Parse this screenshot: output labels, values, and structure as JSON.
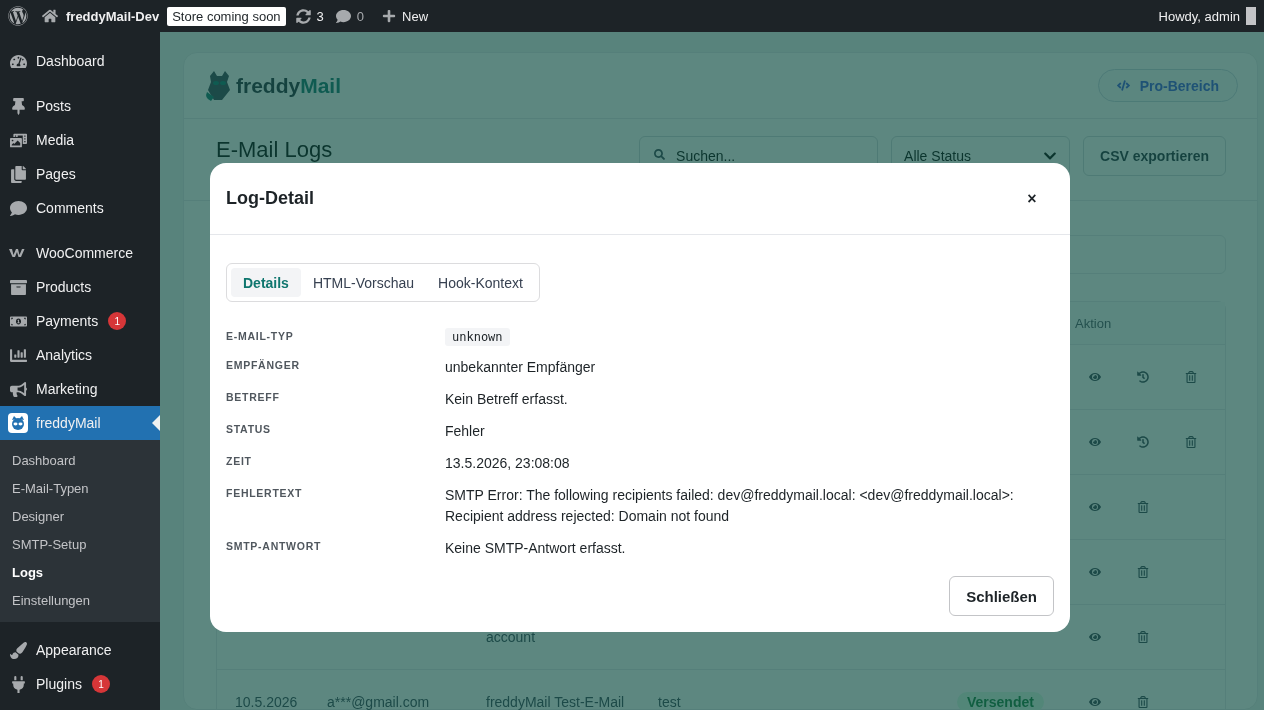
{
  "admin_bar": {
    "site": "freddyMail-Dev",
    "store_badge": "Store coming soon",
    "updates": "3",
    "comments": "0",
    "new": "New",
    "greeting": "Howdy, admin"
  },
  "sidebar": {
    "groups": [
      [
        {
          "label": "Dashboard",
          "selected": false
        }
      ],
      [
        {
          "label": "Posts",
          "selected": false
        },
        {
          "label": "Media",
          "selected": false
        },
        {
          "label": "Pages",
          "selected": false
        },
        {
          "label": "Comments",
          "selected": false
        }
      ],
      [
        {
          "label": "WooCommerce",
          "selected": false
        },
        {
          "label": "Products",
          "selected": false
        },
        {
          "label": "Payments",
          "selected": false,
          "badge": "1"
        },
        {
          "label": "Analytics",
          "selected": false
        },
        {
          "label": "Marketing",
          "selected": false
        },
        {
          "label": "freddyMail",
          "selected": true,
          "children": [
            {
              "label": "Dashboard",
              "selected": false
            },
            {
              "label": "E-Mail-Typen",
              "selected": false
            },
            {
              "label": "Designer",
              "selected": false
            },
            {
              "label": "SMTP-Setup",
              "selected": false
            },
            {
              "label": "Logs",
              "selected": true
            },
            {
              "label": "Einstellungen",
              "selected": false
            }
          ]
        }
      ],
      [
        {
          "label": "Appearance",
          "selected": false
        },
        {
          "label": "Plugins",
          "selected": false,
          "badge": "1"
        }
      ]
    ]
  },
  "header": {
    "logo": {
      "parts": [
        "freddy",
        "Mail"
      ]
    },
    "pro_button": "Pro-Bereich"
  },
  "toolbar": {
    "title": "E-Mail Logs",
    "search": {
      "placeholder": "Suchen..."
    },
    "status_filter": "Alle Status",
    "export_button": "CSV exportieren"
  },
  "table": {
    "columns": [
      "Aktion"
    ],
    "rows": [
      {
        "actions": [
          {
            "kind": "view"
          },
          {
            "kind": "resend"
          },
          {
            "kind": "delete"
          }
        ]
      },
      {
        "actions": [
          {
            "kind": "view"
          },
          {
            "kind": "resend"
          },
          {
            "kind": "delete"
          }
        ]
      },
      {
        "actions": [
          {
            "kind": "view"
          },
          {
            "kind": "delete"
          }
        ]
      },
      {
        "actions": [
          {
            "kind": "view"
          },
          {
            "kind": "delete"
          }
        ]
      },
      {
        "subject": "account",
        "actions": [
          {
            "kind": "view"
          },
          {
            "kind": "delete"
          }
        ]
      },
      {
        "date": "10.5.2026",
        "recipient": "a***@gmail.com",
        "subject": "freddyMail Test-E-Mail",
        "type": "test",
        "status": {
          "label": "Versendet",
          "kind": "sent"
        },
        "actions": [
          {
            "kind": "view"
          },
          {
            "kind": "delete"
          }
        ]
      }
    ]
  },
  "modal": {
    "title": "Log-Detail",
    "close": "×",
    "tabs": [
      {
        "label": "Details",
        "selected": true
      },
      {
        "label": "HTML-Vorschau",
        "selected": false
      },
      {
        "label": "Hook-Kontext",
        "selected": false
      }
    ],
    "fields": [
      {
        "label": "E-MAIL-TYP",
        "value": "unknown",
        "kind": "code"
      },
      {
        "label": "EMPFÄNGER",
        "value": "unbekannter Empfänger",
        "kind": "text"
      },
      {
        "label": "BETREFF",
        "value": "Kein Betreff erfasst.",
        "kind": "text"
      },
      {
        "label": "STATUS",
        "value": "Fehler",
        "kind": "text"
      },
      {
        "label": "ZEIT",
        "value": "13.5.2026, 23:08:08",
        "kind": "text"
      },
      {
        "label": "FEHLERTEXT",
        "value": "SMTP Error: The following recipients failed: dev@freddymail.local: <dev@freddymail.local>: Recipient address rejected: Domain not found",
        "kind": "text"
      },
      {
        "label": "SMTP-ANTWORT",
        "value": "Keine SMTP-Antwort erfasst.",
        "kind": "text"
      }
    ],
    "close_button": "Schließen"
  }
}
